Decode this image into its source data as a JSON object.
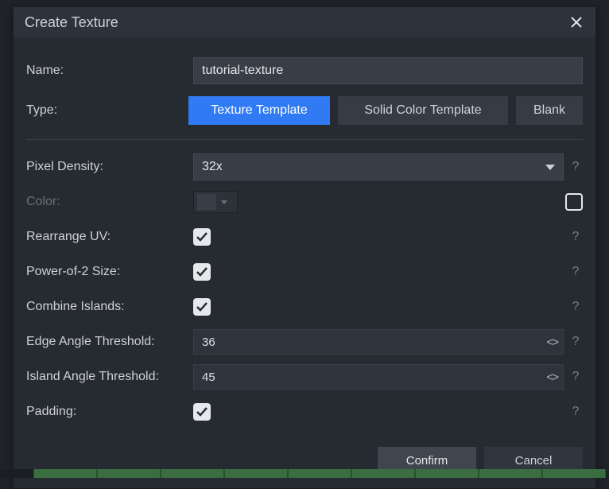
{
  "dialog": {
    "title": "Create Texture"
  },
  "fields": {
    "name": {
      "label": "Name:",
      "value": "tutorial-texture"
    },
    "type": {
      "label": "Type:",
      "options": {
        "texture_template": "Texture Template",
        "solid_color_template": "Solid Color Template",
        "blank": "Blank"
      },
      "selected": "texture_template"
    },
    "pixel_density": {
      "label": "Pixel Density:",
      "value": "32x",
      "help": "?"
    },
    "color": {
      "label": "Color:",
      "swatch": "#3a3f47",
      "enabled": false
    },
    "rearrange_uv": {
      "label": "Rearrange UV:",
      "checked": true,
      "help": "?"
    },
    "power_of_2": {
      "label": "Power-of-2 Size:",
      "checked": true,
      "help": "?"
    },
    "combine_islands": {
      "label": "Combine Islands:",
      "checked": true,
      "help": "?"
    },
    "edge_angle_threshold": {
      "label": "Edge Angle Threshold:",
      "value": "36",
      "help": "?"
    },
    "island_angle_threshold": {
      "label": "Island Angle Threshold:",
      "value": "45",
      "help": "?"
    },
    "padding": {
      "label": "Padding:",
      "checked": true,
      "help": "?"
    }
  },
  "buttons": {
    "confirm": "Confirm",
    "cancel": "Cancel"
  }
}
